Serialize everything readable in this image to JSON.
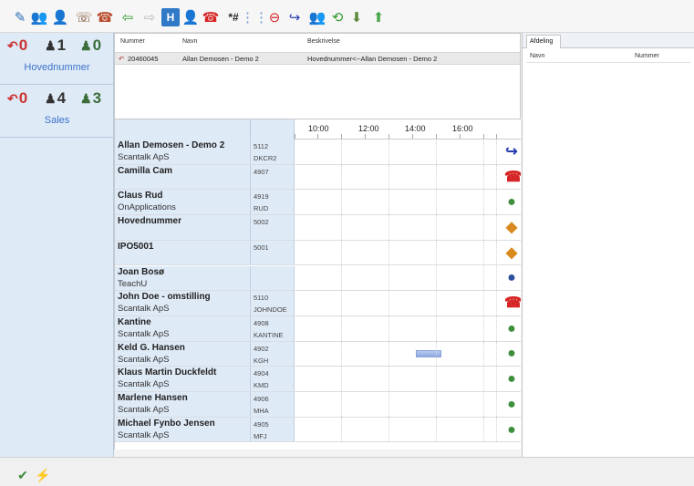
{
  "toolbar": {
    "icons": [
      {
        "name": "edit-note-icon",
        "glyph": "✎",
        "color": "#2f6fb8"
      },
      {
        "name": "group-users-icon",
        "glyph": "👥",
        "color": "#b86a2b"
      },
      {
        "name": "user-grey-icon",
        "glyph": "👤",
        "color": "#9a9a9a"
      },
      {
        "name": "user-phone-icon",
        "glyph": "☏",
        "color": "#7a4b2a"
      },
      {
        "name": "user-call-icon",
        "glyph": "☎",
        "color": "#b84a2b"
      },
      {
        "name": "transfer-in-icon",
        "glyph": "⇦",
        "color": "#2e9a2e"
      },
      {
        "name": "transfer-out-disabled-icon",
        "glyph": "⇨",
        "color": "#b9b9b9"
      },
      {
        "name": "hold-icon",
        "glyph": "H",
        "color": "#ffffff"
      },
      {
        "name": "user-disabled-icon",
        "glyph": "👤",
        "color": "#c0c0c0"
      },
      {
        "name": "hangup-icon",
        "glyph": "☎",
        "color": "#d62424"
      },
      {
        "name": "dtmf-star-hash-icon",
        "glyph": "*#",
        "color": "#222222"
      },
      {
        "name": "keypad-icon",
        "glyph": "⋮⋮",
        "color": "#6a8fcf"
      },
      {
        "name": "do-not-disturb-icon",
        "glyph": "⊖",
        "color": "#d62424"
      },
      {
        "name": "forward-icon",
        "glyph": "↪",
        "color": "#2a3fb0"
      },
      {
        "name": "conference-disabled-icon",
        "glyph": "👥",
        "color": "#c0c0c0"
      },
      {
        "name": "back-icon",
        "glyph": "⟲",
        "color": "#2e9a2e"
      },
      {
        "name": "download-icon",
        "glyph": "⬇",
        "color": "#5a8a3a"
      },
      {
        "name": "upload-icon",
        "glyph": "⬆",
        "color": "#4aa84a"
      }
    ]
  },
  "groups": [
    {
      "name": "Hovednummer",
      "calls": "0",
      "busy": "1",
      "free": "0"
    },
    {
      "name": "Sales",
      "calls": "0",
      "busy": "4",
      "free": "3"
    }
  ],
  "info": {
    "headers": {
      "number": "Nummer",
      "name": "Navn",
      "description": "Beskrivelse"
    },
    "row": {
      "number": "20460045",
      "name": "Allan Demosen - Demo 2",
      "description": "Hovednummer<--Allan Demosen - Demo 2"
    }
  },
  "right_panel": {
    "tab": "Afdeling",
    "headers": {
      "name": "Navn",
      "number": "Nummer"
    }
  },
  "timeline": {
    "ticks": [
      "10:00",
      "12:00",
      "14:00",
      "16:00"
    ]
  },
  "contacts": [
    {
      "name": "Allan Demosen - Demo 2",
      "company": "Scantalk ApS",
      "ext": "5112",
      "initials": "DKCR2",
      "status_icon": "forward-icon",
      "glyph": "↪",
      "color": "#2a3fb0"
    },
    {
      "name": "Camilla Cam",
      "company": "",
      "ext": "4907",
      "initials": "",
      "status_icon": "phone-busy-icon",
      "glyph": "☎",
      "color": "#d62424"
    },
    {
      "name": "Claus Rud",
      "company": "OnApplications",
      "ext": "4919",
      "initials": "RUD",
      "status_icon": "user-available-icon",
      "glyph": "●",
      "color": "#3d8f3d"
    },
    {
      "name": "Hovednummer",
      "company": "",
      "ext": "5002",
      "initials": "",
      "status_icon": "group-icon",
      "glyph": "◆",
      "color": "#d88a1e"
    },
    {
      "name": "IPO5001",
      "company": "",
      "ext": "5001",
      "initials": "",
      "status_icon": "group-icon",
      "glyph": "◆",
      "color": "#d88a1e"
    },
    {
      "name": "Joan Bosø",
      "company": "TeachU",
      "ext": "",
      "initials": "",
      "status_icon": "user-away-icon",
      "glyph": "●",
      "color": "#2f4f9f"
    },
    {
      "name": "John Doe - omstilling",
      "company": "Scantalk ApS",
      "ext": "5110",
      "initials": "JOHNDOE",
      "status_icon": "phone-busy-icon",
      "glyph": "☎",
      "color": "#d62424"
    },
    {
      "name": "Kantine",
      "company": "Scantalk ApS",
      "ext": "4908",
      "initials": "KANTINE",
      "status_icon": "user-available-icon",
      "glyph": "●",
      "color": "#3d8f3d"
    },
    {
      "name": "Keld G. Hansen",
      "company": "Scantalk ApS",
      "ext": "4902",
      "initials": "KGH",
      "status_icon": "user-available-icon",
      "glyph": "●",
      "color": "#3d8f3d"
    },
    {
      "name": "Klaus Martin Duckfeldt",
      "company": "Scantalk ApS",
      "ext": "4904",
      "initials": "KMD",
      "status_icon": "user-available-icon",
      "glyph": "●",
      "color": "#3d8f3d"
    },
    {
      "name": "Marlene Hansen",
      "company": "Scantalk ApS",
      "ext": "4906",
      "initials": "MHA",
      "status_icon": "user-available-icon",
      "glyph": "●",
      "color": "#3d8f3d"
    },
    {
      "name": "Michael Fynbo Jensen",
      "company": "Scantalk ApS",
      "ext": "4905",
      "initials": "MFJ",
      "status_icon": "user-available-icon",
      "glyph": "●",
      "color": "#3d8f3d"
    }
  ],
  "statusbar": {
    "icons": [
      {
        "name": "check-icon",
        "glyph": "✔",
        "color": "#3a8a3a"
      },
      {
        "name": "connection-icon",
        "glyph": "⚡",
        "color": "#5a9a5a"
      }
    ]
  },
  "colors": {
    "accent": "#3b72c7",
    "busy": "#d62424",
    "available": "#3d8f3d"
  }
}
